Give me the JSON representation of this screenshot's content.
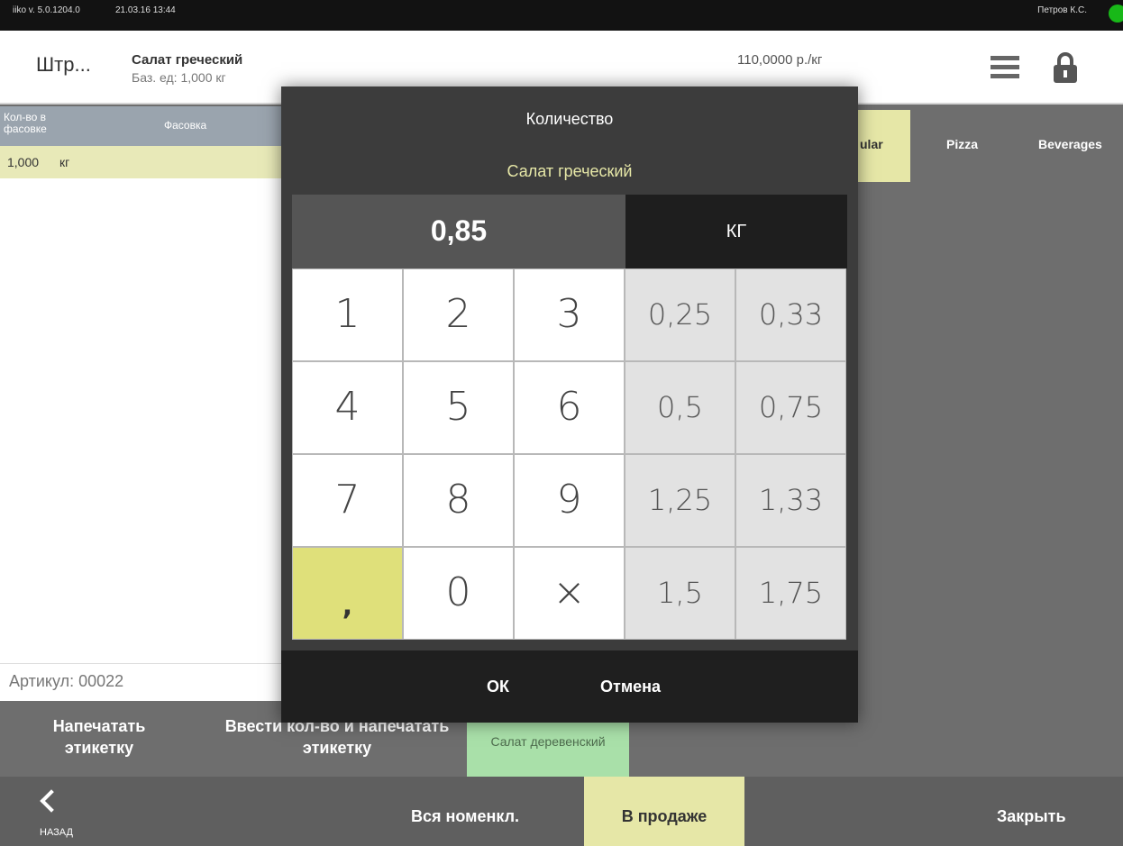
{
  "status": {
    "version": "iiko v. 5.0.1204.0",
    "datetime": "21.03.16 13:44",
    "user": "Петров К.С."
  },
  "header": {
    "mode": "Штр...",
    "product_name": "Салат греческий",
    "base_unit": "Баз. ед: 1,000 кг",
    "price": "110,0000 р./кг"
  },
  "table": {
    "col1": "Кол-во в фасовке",
    "col2": "Фасовка",
    "row_value": "1,000",
    "row_unit": "кг"
  },
  "artikul": "Артикул: 00022",
  "categories": {
    "regular": "ular",
    "pizza": "Pizza",
    "beverages": "Beverages"
  },
  "actions": {
    "print_label": "Напечатать этикетку",
    "enter_qty_print": "Ввести кол-во и напечатать этикетку",
    "tile": "Салат деревенский"
  },
  "bottom": {
    "back": "НАЗАД",
    "all": "Вся номенкл.",
    "on_sale": "В продаже",
    "close": "Закрыть"
  },
  "modal": {
    "title": "Количество",
    "subtitle": "Салат греческий",
    "value": "0,85",
    "unit": "КГ",
    "keys": [
      "1",
      "2",
      "3",
      "4",
      "5",
      "6",
      "7",
      "8",
      "9",
      ",",
      "0",
      "×"
    ],
    "presets": [
      "0,25",
      "0,33",
      "0,5",
      "0,75",
      "1,25",
      "1,33",
      "1,5",
      "1,75"
    ],
    "ok": "ОК",
    "cancel": "Отмена"
  }
}
